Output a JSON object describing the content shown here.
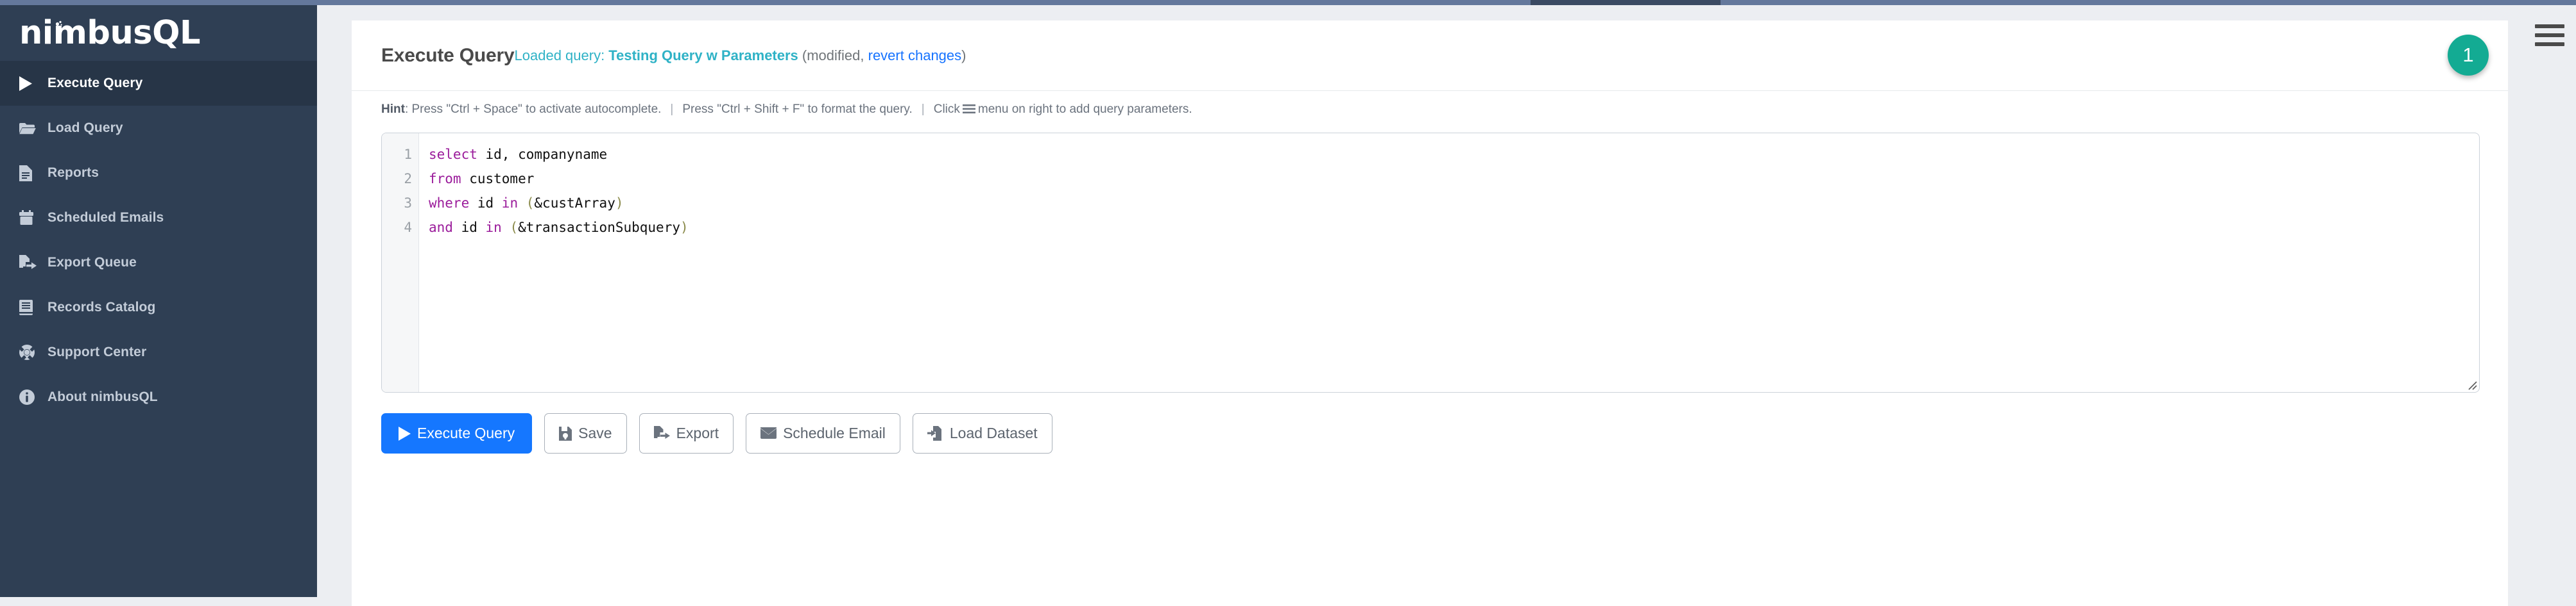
{
  "colors": {
    "sidebar_bg": "#2F3F54",
    "sidebar_active_bg": "#273547",
    "accent_teal": "#2FB2C6",
    "badge_teal": "#13AB93",
    "primary_blue": "#1577FF",
    "link_blue": "#1673FF",
    "keyword_purple": "#9B1C9B",
    "paren_olive": "#8A8A4A"
  },
  "sidebar": {
    "brand": "nimbusQL",
    "items": [
      {
        "label": "Execute Query",
        "icon": "play-icon",
        "active": true
      },
      {
        "label": "Load Query",
        "icon": "folder-open-icon",
        "active": false
      },
      {
        "label": "Reports",
        "icon": "document-icon",
        "active": false
      },
      {
        "label": "Scheduled Emails",
        "icon": "calendar-icon",
        "active": false
      },
      {
        "label": "Export Queue",
        "icon": "file-export-icon",
        "active": false
      },
      {
        "label": "Records Catalog",
        "icon": "book-icon",
        "active": false
      },
      {
        "label": "Support Center",
        "icon": "life-ring-icon",
        "active": false
      },
      {
        "label": "About nimbusQL",
        "icon": "info-circle-icon",
        "active": false
      }
    ]
  },
  "header": {
    "title": "Execute Query",
    "loaded_prefix": "Loaded query: ",
    "loaded_query_name": "Testing Query w Parameters",
    "modified_open": " (modified, ",
    "revert_link": "revert changes",
    "modified_close": ")",
    "badge_count": "1"
  },
  "hint": {
    "label": "Hint",
    "part1": ": Press \"Ctrl + Space\" to activate autocomplete.",
    "separator": "|",
    "part2": "Press \"Ctrl + Shift + F\" to format the query.",
    "part3_pre": "Click",
    "part3_post": "menu on right to add query parameters."
  },
  "editor": {
    "line_numbers": [
      "1",
      "2",
      "3",
      "4"
    ],
    "lines": [
      [
        {
          "t": "select",
          "c": "kw"
        },
        {
          "t": " id, companyname",
          "c": "ident"
        }
      ],
      [
        {
          "t": "from",
          "c": "kw"
        },
        {
          "t": " customer",
          "c": "ident"
        }
      ],
      [
        {
          "t": "where",
          "c": "kw"
        },
        {
          "t": " id ",
          "c": "ident"
        },
        {
          "t": "in",
          "c": "kw"
        },
        {
          "t": " ",
          "c": "ident"
        },
        {
          "t": "(",
          "c": "punct"
        },
        {
          "t": "&custArray",
          "c": "ident"
        },
        {
          "t": ")",
          "c": "punct"
        }
      ],
      [
        {
          "t": "and",
          "c": "kw"
        },
        {
          "t": " id ",
          "c": "ident"
        },
        {
          "t": "in",
          "c": "kw"
        },
        {
          "t": " ",
          "c": "ident"
        },
        {
          "t": "(",
          "c": "punct"
        },
        {
          "t": "&transactionSubquery",
          "c": "ident"
        },
        {
          "t": ")",
          "c": "punct"
        }
      ]
    ],
    "plain_text": "select id, companyname\nfrom customer\nwhere id in (&custArray)\nand id in (&transactionSubquery)"
  },
  "buttons": [
    {
      "label": "Execute Query",
      "icon": "play-icon",
      "style": "primary"
    },
    {
      "label": "Save",
      "icon": "save-icon",
      "style": "default"
    },
    {
      "label": "Export",
      "icon": "file-export-icon",
      "style": "default"
    },
    {
      "label": "Schedule Email",
      "icon": "envelope-icon",
      "style": "default"
    },
    {
      "label": "Load Dataset",
      "icon": "import-icon",
      "style": "default"
    }
  ],
  "right_rail": {
    "menu_icon": "hamburger-menu-icon"
  }
}
